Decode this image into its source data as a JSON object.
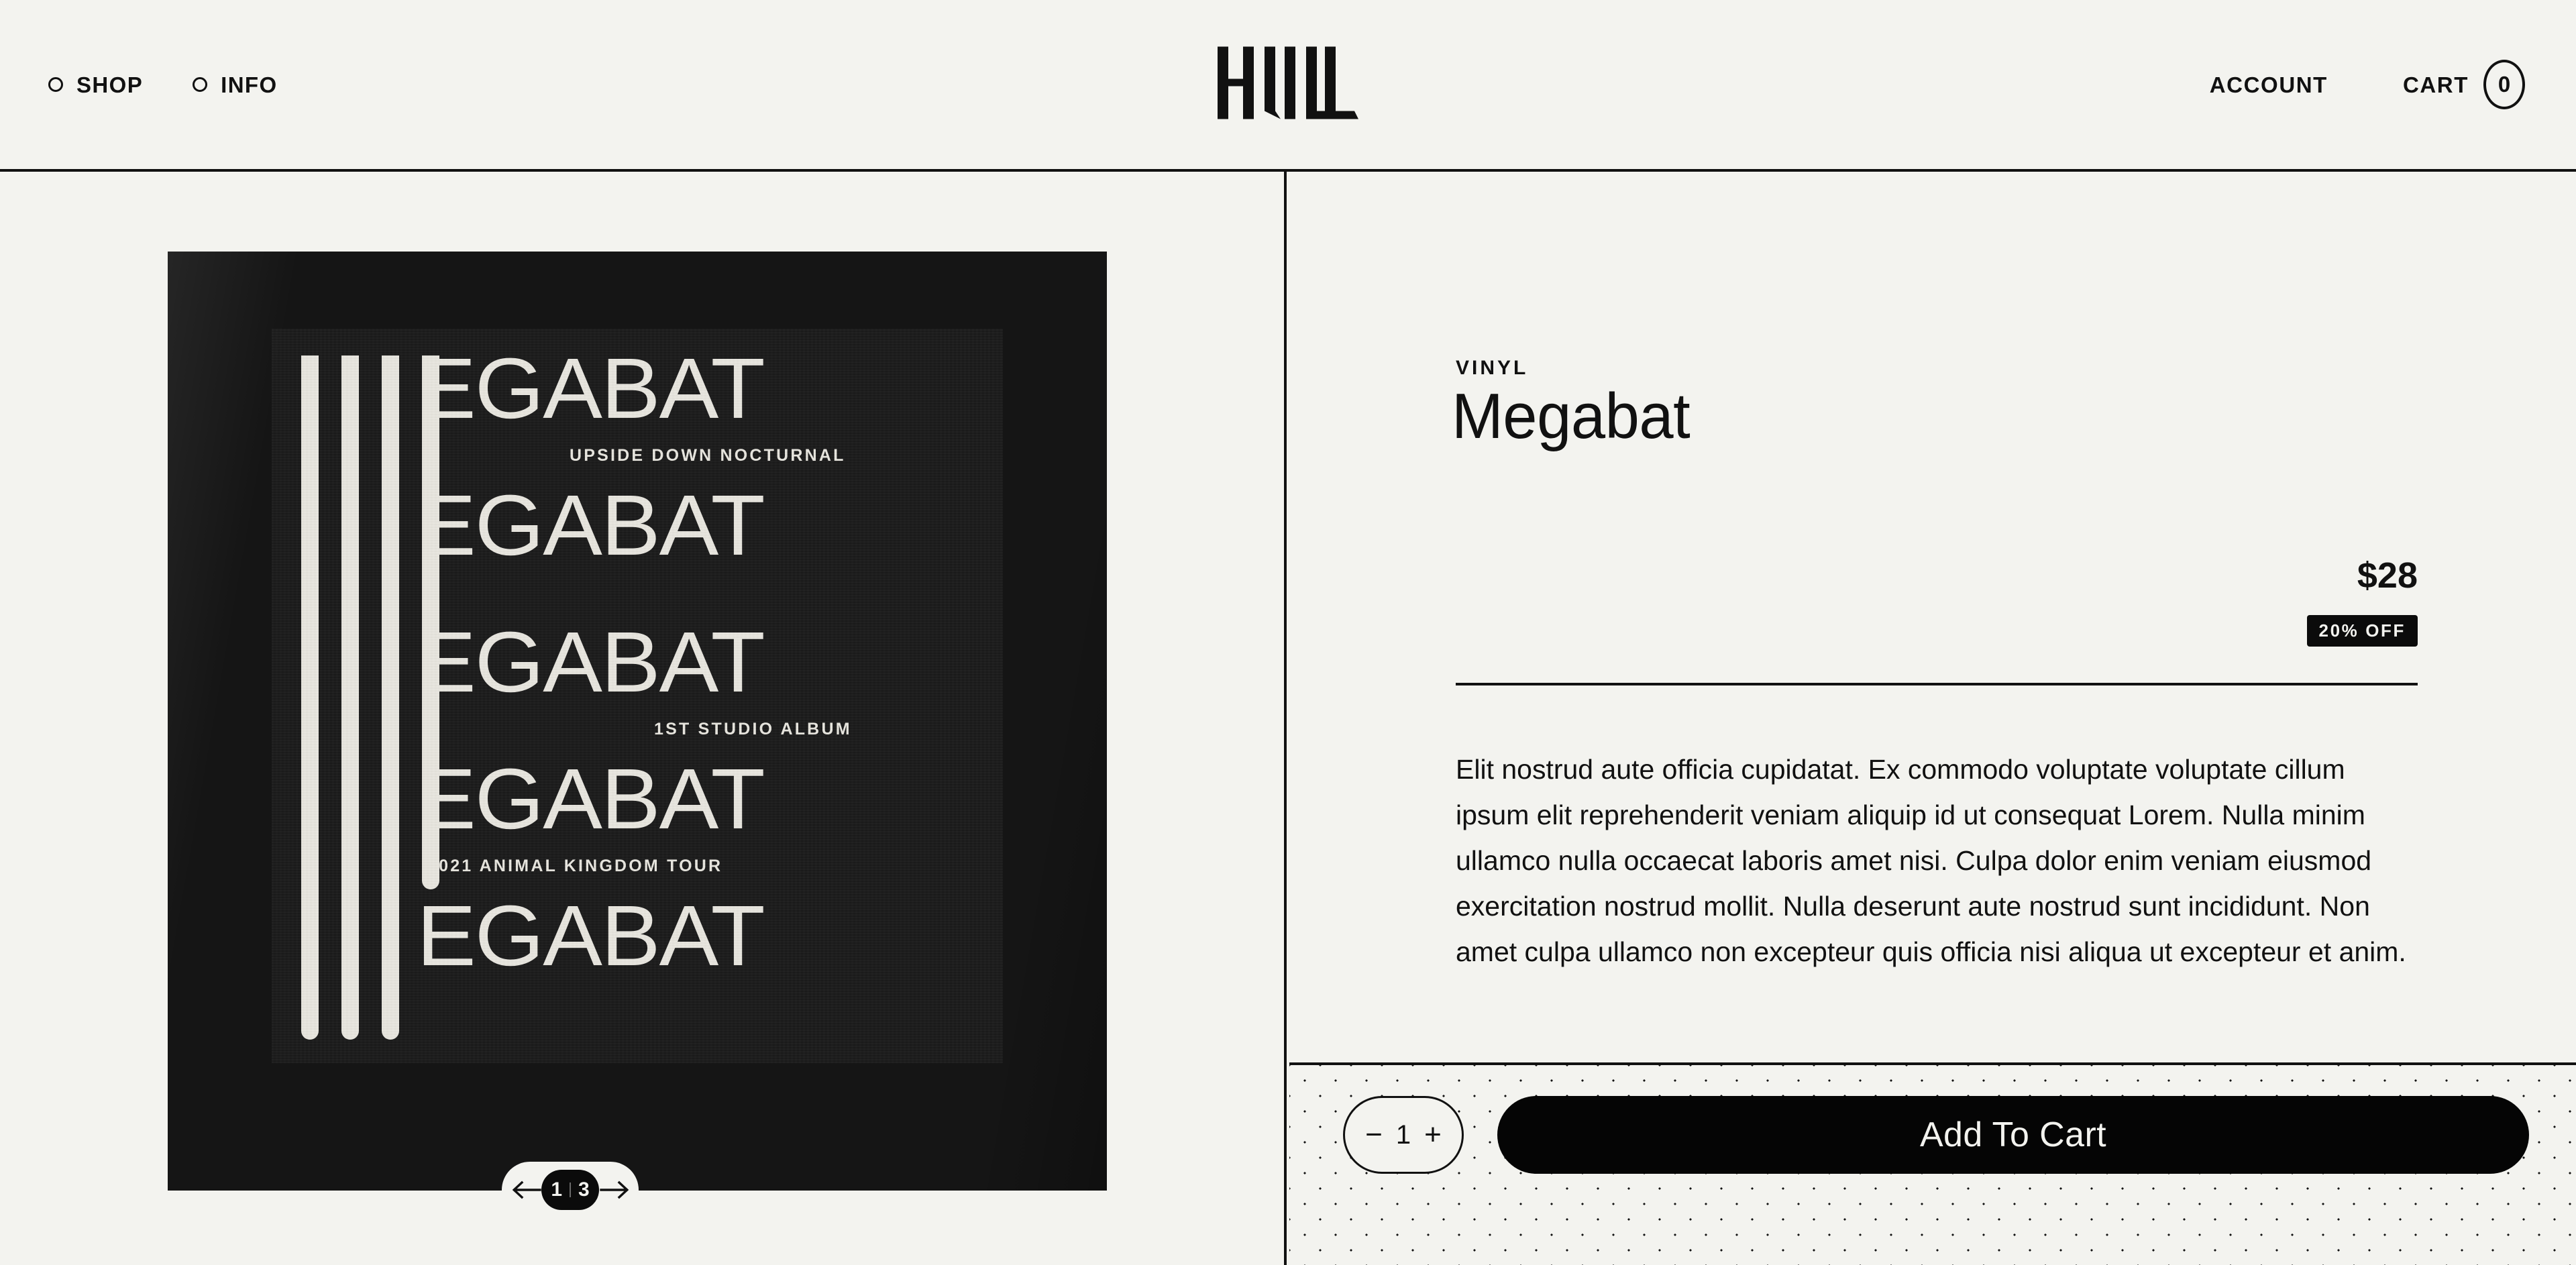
{
  "header": {
    "nav": [
      {
        "label": "SHOP",
        "icon": "circle-icon"
      },
      {
        "label": "INFO",
        "icon": "circle-icon"
      }
    ],
    "logo": "HULL",
    "account_label": "ACCOUNT",
    "cart_label": "CART",
    "cart_count": "0"
  },
  "gallery": {
    "artwork": {
      "word": "EGABAT",
      "lines": [
        "EGABAT",
        "EGABAT",
        "EGABAT",
        "EGABAT",
        "EGABAT"
      ],
      "captions": [
        "UPSIDE DOWN NOCTURNAL",
        "1ST STUDIO ALBUM",
        "2021 ANIMAL KINGDOM TOUR"
      ]
    },
    "pager": {
      "prev_icon": "arrow-left-icon",
      "next_icon": "arrow-right-icon",
      "current": "1",
      "separator": "",
      "total": "3"
    }
  },
  "product": {
    "category": "VINYL",
    "name": "Megabat",
    "price": "$28",
    "discount_badge": "20% OFF",
    "description": "Elit nostrud aute officia cupidatat. Ex commodo voluptate voluptate cillum ipsum elit reprehenderit veniam aliquip id ut consequat Lorem. Nulla minim ullamco nulla occaecat laboris amet nisi. Culpa dolor enim veniam eiusmod exercitation nostrud mollit. Nulla deserunt aute nostrud sunt incididunt. Non amet culpa ullamco non excepteur quis officia nisi aliqua ut excepteur et anim."
  },
  "actions": {
    "decrement_label": "−",
    "quantity": "1",
    "increment_label": "+",
    "add_to_cart_label": "Add To Cart"
  },
  "colors": {
    "background": "#F3F3EF",
    "ink": "#111111",
    "artwork_bg": "#151515",
    "artwork_ink": "#E8E6DF"
  }
}
